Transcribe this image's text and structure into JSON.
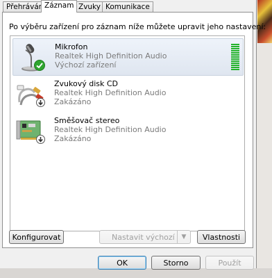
{
  "tabs": [
    {
      "label": "Přehrávání",
      "active": false
    },
    {
      "label": "Záznam",
      "active": true
    },
    {
      "label": "Zvuky",
      "active": false
    },
    {
      "label": "Komunikace",
      "active": false
    }
  ],
  "instruction": "Po výběru zařízení pro záznam níže můžete upravit jeho nastavení:",
  "devices": [
    {
      "name": "Mikrofon",
      "driver": "Realtek High Definition Audio",
      "status": "Výchozí zařízení",
      "icon": "microphone-icon",
      "badge": "default-check-icon",
      "selected": true,
      "level": 1.0
    },
    {
      "name": "Zvukový disk CD",
      "driver": "Realtek High Definition Audio",
      "status": "Zakázáno",
      "icon": "cd-audio-cable-icon",
      "badge": "disabled-arrow-icon",
      "selected": false
    },
    {
      "name": "Směšovač stereo",
      "driver": "Realtek High Definition Audio",
      "status": "Zakázáno",
      "icon": "sound-card-icon",
      "badge": "disabled-arrow-icon",
      "selected": false
    }
  ],
  "buttons": {
    "configure": "Konfigurovat",
    "set_default": "Nastavit výchozí",
    "properties": "Vlastnosti",
    "ok": "OK",
    "cancel": "Storno",
    "apply": "Použít"
  },
  "colors": {
    "meter_green": "#22b32a",
    "selection_bg": "#dfe6f0",
    "default_check": "#2fa52f"
  }
}
